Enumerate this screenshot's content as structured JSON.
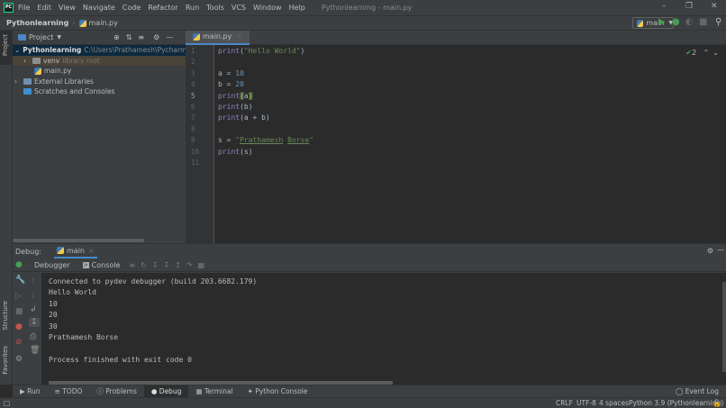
{
  "menubar": {
    "items": [
      "File",
      "Edit",
      "View",
      "Navigate",
      "Code",
      "Refactor",
      "Run",
      "Tools",
      "VCS",
      "Window",
      "Help"
    ],
    "window_title": "Pythonlearning - main.py"
  },
  "navbar": {
    "project": "Pythonlearning",
    "file": "main.py"
  },
  "toolbar": {
    "run_config": "main"
  },
  "left_stripe": {
    "project": "Project",
    "structure": "Structure",
    "favorites": "Favorites"
  },
  "project_panel": {
    "title": "Project",
    "root": "Pythonlearning",
    "root_path": "C:\\Users\\Prathamesh\\PycharmProjec",
    "venv": "venv",
    "venv_note": "library root",
    "file": "main.py",
    "ext_libs": "External Libraries",
    "scratches": "Scratches and Consoles"
  },
  "editor": {
    "tab": "main.py",
    "inspections": "2",
    "lines": [
      "1",
      "2",
      "3",
      "4",
      "5",
      "6",
      "7",
      "8",
      "9",
      "10",
      "11"
    ]
  },
  "debug": {
    "label": "Debug:",
    "session": "main",
    "tab_debugger": "Debugger",
    "tab_console": "Console",
    "console": [
      "Connected to pydev debugger (build 203.6682.179)",
      "Hello World",
      "10",
      "20",
      "30",
      "Prathamesh Borse",
      "",
      "Process finished with exit code 0"
    ]
  },
  "bottom_tabs": [
    "Run",
    "TODO",
    "Problems",
    "Debug",
    "Terminal",
    "Python Console"
  ],
  "status": {
    "event_log": "Event Log",
    "line_sep": "CRLF",
    "encoding": "UTF-8",
    "indent": "4 spaces",
    "interpreter": "Python 3.9 (Pythonlearning)"
  }
}
